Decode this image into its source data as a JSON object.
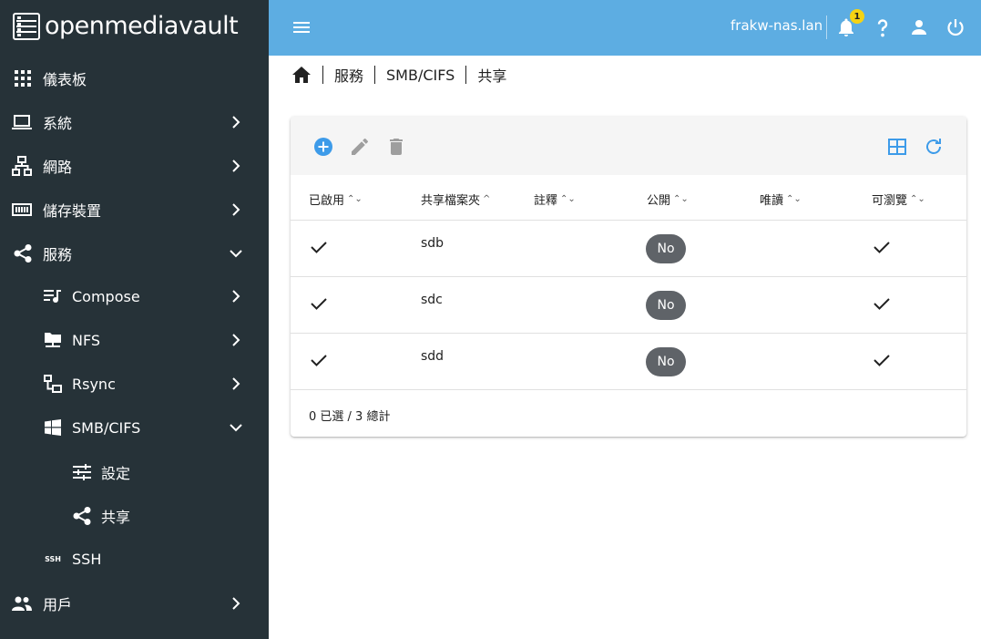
{
  "app": {
    "logo_text": "openmediavault"
  },
  "sidebar": {
    "items": [
      {
        "label": "儀表板",
        "icon": "dashboard-grid-icon"
      },
      {
        "label": "系統",
        "icon": "laptop-icon"
      },
      {
        "label": "網路",
        "icon": "network-icon"
      },
      {
        "label": "儲存裝置",
        "icon": "storage-icon"
      },
      {
        "label": "服務",
        "icon": "share-icon"
      },
      {
        "label": "Compose",
        "icon": "playlist-music-icon"
      },
      {
        "label": "NFS",
        "icon": "folder-network-icon"
      },
      {
        "label": "Rsync",
        "icon": "lan-icon"
      },
      {
        "label": "SMB/CIFS",
        "icon": "windows-icon"
      },
      {
        "label": "設定",
        "icon": "tune-icon"
      },
      {
        "label": "共享",
        "icon": "share-icon"
      },
      {
        "label": "SSH",
        "icon": "ssh-icon"
      },
      {
        "label": "用戶",
        "icon": "users-icon"
      }
    ]
  },
  "topbar": {
    "hostname": "frakw-nas.lan",
    "notification_count": "1"
  },
  "breadcrumb": {
    "items": [
      "服務",
      "SMB/CIFS",
      "共享"
    ]
  },
  "table": {
    "columns": [
      "已啟用",
      "共享檔案夾",
      "註釋",
      "公開",
      "唯讀",
      "可瀏覽"
    ],
    "sort_neutral": "⌃⌄",
    "sort_asc": "^",
    "rows": [
      {
        "enabled": true,
        "shared_folder": "sdb",
        "comment": "",
        "public": "No",
        "readonly": false,
        "browseable": true
      },
      {
        "enabled": true,
        "shared_folder": "sdc",
        "comment": "",
        "public": "No",
        "readonly": false,
        "browseable": true
      },
      {
        "enabled": true,
        "shared_folder": "sdd",
        "comment": "",
        "public": "No",
        "readonly": false,
        "browseable": true
      }
    ],
    "footer": "0 已選 / 3 總計"
  },
  "colors": {
    "sidebar_bg": "#263238",
    "topbar_bg": "#5dade2",
    "accent": "#3d9be9",
    "badge": "#f5d313",
    "chip_bg": "#5f6368"
  }
}
